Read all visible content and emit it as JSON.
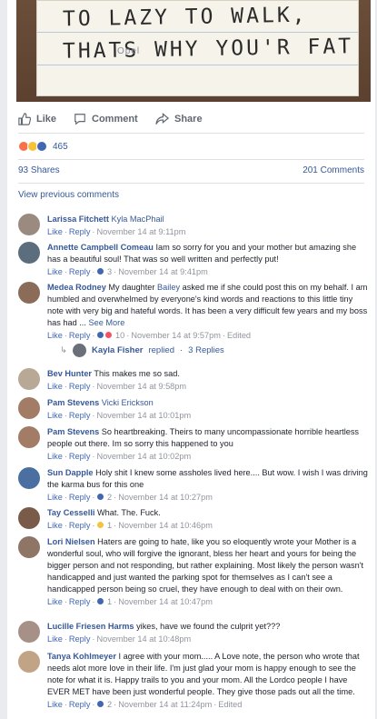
{
  "post": {
    "photo_text_line1": "TO LAZY TO WALK,",
    "photo_text_line2": "THATS WHY YOU'R FAT",
    "photo_brand": "Opel"
  },
  "actions": {
    "like": "Like",
    "comment": "Comment",
    "share": "Share"
  },
  "reactions": {
    "count": "465",
    "types": [
      "angry",
      "sad",
      "like"
    ],
    "colors": {
      "angry": "#f7714c",
      "sad": "#f5c33b",
      "like": "#4267b2"
    }
  },
  "stats": {
    "shares": "93 Shares",
    "comments": "201 Comments"
  },
  "view_previous": "View previous comments",
  "labels": {
    "like": "Like",
    "reply": "Reply",
    "sep": "·"
  },
  "comments": [
    {
      "author": "Larissa Fitchett",
      "tag": "Kyla MacPhail",
      "text": "",
      "reactions": "",
      "time": "November 14 at 9:11pm",
      "edited": ""
    },
    {
      "author": "Annette Campbell Comeau",
      "tag": "",
      "text": "Iam so sorry for you and your mother but amazing she has a beautiful soul! That was so well written and perfectly put!",
      "reactions": "3",
      "time": "November 14 at 9:41pm",
      "edited": ""
    },
    {
      "author": "Medea Rodney",
      "tag": "",
      "text_pre": "My daughter ",
      "tag_inline": "Bailey",
      "text": "asked me if she could post this on my behalf. I am humbled and overwhelmed by everyone's kind words and reactions to this little tiny note with very big and hateful words. It has been a very difficult few years and my boss has had ...",
      "see_more": "See More",
      "reactions": "10",
      "time": "November 14 at 9:57pm",
      "edited": "Edited"
    },
    {
      "author": "Bev Hunter",
      "tag": "",
      "text": "This makes me so sad.",
      "reactions": "",
      "time": "November 14 at 9:58pm",
      "edited": ""
    },
    {
      "author": "Pam Stevens",
      "tag": "Vicki Erickson",
      "text": "",
      "reactions": "",
      "time": "November 14 at 10:01pm",
      "edited": ""
    },
    {
      "author": "Pam Stevens",
      "tag": "",
      "text": "So heartbreaking. Theirs to many uncompassionate horrible heartless people out there. Im so sorry this happened to you",
      "reactions": "",
      "time": "November 14 at 10:02pm",
      "edited": ""
    },
    {
      "author": "Sun Dapple",
      "tag": "",
      "text": "Holy shit I knew some assholes lived here.... But wow. I wish I was driving the karma bus for this one",
      "reactions": "2",
      "time": "November 14 at 10:27pm",
      "edited": ""
    },
    {
      "author": "Tay Cesselli",
      "tag": "",
      "text": "What. The. Fuck.",
      "reactions": "1",
      "time": "November 14 at 10:46pm",
      "edited": ""
    },
    {
      "author": "Lori Nielsen",
      "tag": "",
      "text": "Haters are going to hate, like you so eloquently wrote your Mother is a wonderful soul, who will forgive the ignorant, bless her heart and yours for being the bigger person and not responding, but rather explaining. Most likely the person wasn't handicapped and just wanted the parking spot for themselves as I can't see a handicapped person being so cruel, they have enough to deal with on their own.",
      "reactions": "1",
      "time": "November 14 at 10:47pm",
      "edited": ""
    },
    {
      "author": "Lucille Friesen Harms",
      "tag": "",
      "text": "yikes, have we found the culprit yet???",
      "reactions": "",
      "time": "November 14 at 10:48pm",
      "edited": ""
    },
    {
      "author": "Tanya Kohlmeyer",
      "tag": "",
      "text": "I agree with your mom..... A Love note, the person who wrote that needs alot more love in their life. I'm just glad your mom is happy enough to see the note for what it is. Happy trails to you and your mom. All the Lordco people I have EVER MET have been just wonderful people. They give those pads out all the time.",
      "reactions": "2",
      "time": "November 14 at 11:24pm",
      "edited": "Edited"
    }
  ],
  "reply_summary": {
    "name": "Kayla Fisher",
    "text": "replied",
    "count": "3 Replies"
  }
}
